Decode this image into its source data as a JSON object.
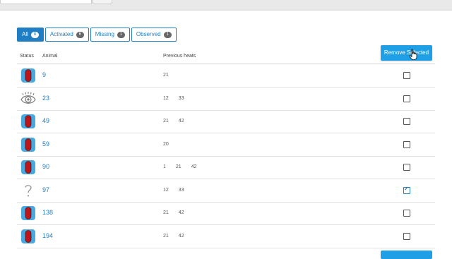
{
  "tabs": [
    {
      "label": "All",
      "count": "8",
      "active": true
    },
    {
      "label": "Activated",
      "count": "6",
      "active": false
    },
    {
      "label": "Missing",
      "count": "1",
      "active": false
    },
    {
      "label": "Observed",
      "count": "1",
      "active": false
    }
  ],
  "actions": {
    "remove_selected": "Remove Selected"
  },
  "table": {
    "headers": {
      "status": "Status",
      "animal": "Animal",
      "previous_heats": "Previous heats"
    },
    "rows": [
      {
        "status": "activated",
        "animal": "9",
        "heats": [
          "21"
        ],
        "checked": false
      },
      {
        "status": "observed",
        "animal": "23",
        "heats": [
          "12",
          "33"
        ],
        "checked": false
      },
      {
        "status": "activated",
        "animal": "49",
        "heats": [
          "21",
          "42"
        ],
        "checked": false
      },
      {
        "status": "activated",
        "animal": "59",
        "heats": [
          "20"
        ],
        "checked": false
      },
      {
        "status": "activated",
        "animal": "90",
        "heats": [
          "1",
          "21",
          "42"
        ],
        "checked": false
      },
      {
        "status": "missing",
        "animal": "97",
        "heats": [
          "12",
          "33"
        ],
        "checked": true
      },
      {
        "status": "activated",
        "animal": "138",
        "heats": [
          "21",
          "42"
        ],
        "checked": false
      },
      {
        "status": "activated",
        "animal": "194",
        "heats": [
          "21",
          "42"
        ],
        "checked": false
      }
    ]
  },
  "colors": {
    "accent": "#1f7ec4",
    "button": "#1fa0e6",
    "activated_tag": "#c0141a",
    "activated_frame": "#4aa8de"
  }
}
